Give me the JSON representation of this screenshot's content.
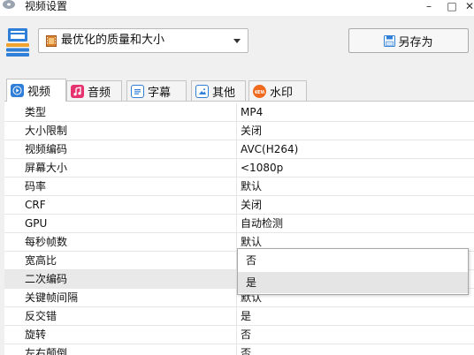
{
  "window": {
    "title": "视频设置",
    "minimize": "–",
    "maximize": "□",
    "close": "✕"
  },
  "toolbar": {
    "preset": {
      "value": "最优化的质量和大小"
    },
    "save_as_label": "另存为"
  },
  "tabs": [
    {
      "label": "视频",
      "icon": "video-icon",
      "active": true
    },
    {
      "label": "音频",
      "icon": "music-note-icon"
    },
    {
      "label": "字幕",
      "icon": "subtitle-icon"
    },
    {
      "label": "其他",
      "icon": "image-icon"
    },
    {
      "label": "水印",
      "icon": "watermark-icon"
    }
  ],
  "properties": [
    {
      "key": "类型",
      "value": "MP4"
    },
    {
      "key": "大小限制",
      "value": "关闭"
    },
    {
      "key": "视频编码",
      "value": "AVC(H264)"
    },
    {
      "key": "屏幕大小",
      "value": "<1080p"
    },
    {
      "key": "码率",
      "value": "默认"
    },
    {
      "key": "CRF",
      "value": "关闭"
    },
    {
      "key": "GPU",
      "value": "自动检测"
    },
    {
      "key": "每秒帧数",
      "value": "默认"
    },
    {
      "key": "宽高比",
      "value": ""
    },
    {
      "key": "二次编码",
      "value": "",
      "selected": true
    },
    {
      "key": "关键帧间隔",
      "value": "默认"
    },
    {
      "key": "反交错",
      "value": "是"
    },
    {
      "key": "旋转",
      "value": "否"
    },
    {
      "key": "左右颠倒",
      "value": "否"
    }
  ],
  "dropdown": {
    "options": [
      {
        "label": "否"
      },
      {
        "label": "是",
        "hover": true
      }
    ]
  },
  "colors": {
    "accent_blue": "#2f7ed8",
    "music_pink": "#e6336f",
    "watermark_orange": "#f06a1d"
  }
}
